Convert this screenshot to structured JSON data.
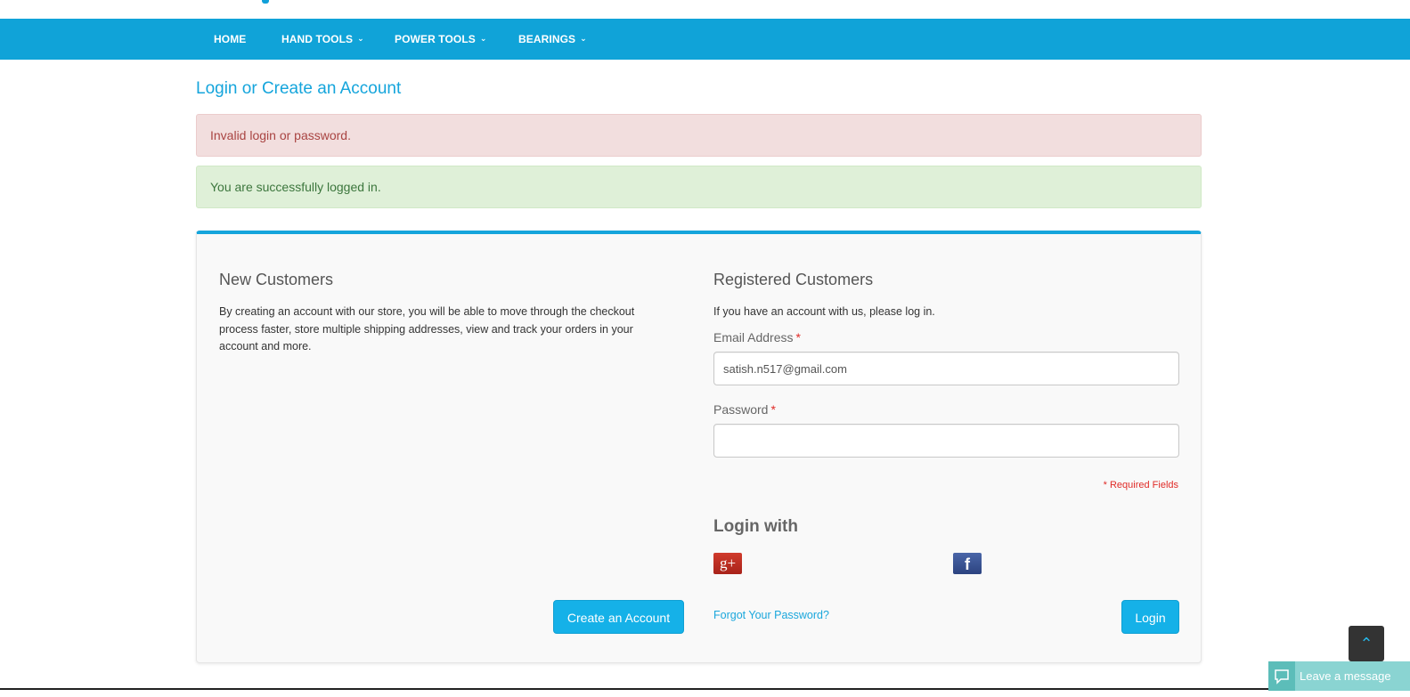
{
  "nav": {
    "items": [
      {
        "label": "HOME",
        "has_dropdown": false
      },
      {
        "label": "HAND TOOLS",
        "has_dropdown": true
      },
      {
        "label": "POWER TOOLS",
        "has_dropdown": true
      },
      {
        "label": "BEARINGS",
        "has_dropdown": true
      }
    ]
  },
  "page": {
    "title": "Login or Create an Account"
  },
  "messages": {
    "error": "Invalid login or password.",
    "success": "You are successfully logged in."
  },
  "new_customers": {
    "heading": "New Customers",
    "description": "By creating an account with our store, you will be able to move through the checkout process faster, store multiple shipping addresses, view and track your orders in your account and more.",
    "button_label": "Create an Account"
  },
  "registered_customers": {
    "heading": "Registered Customers",
    "intro": "If you have an account with us, please log in.",
    "email_label": "Email Address",
    "email_value": "satish.n517@gmail.com",
    "password_label": "Password",
    "password_value": "",
    "required_marker": "*",
    "required_note": "* Required Fields",
    "login_with_heading": "Login with",
    "forgot_link": "Forgot Your Password?",
    "login_button": "Login"
  },
  "social": {
    "google_icon": "google-plus-icon",
    "google_glyph": "g+",
    "facebook_icon": "facebook-icon",
    "facebook_glyph": "f"
  },
  "chat_widget": {
    "label": "Leave a message"
  },
  "colors": {
    "brand": "#10a3d8",
    "button": "#15b1e8",
    "error_bg": "#f2dede",
    "success_bg": "#dff0d8",
    "required": "#e02b27"
  }
}
